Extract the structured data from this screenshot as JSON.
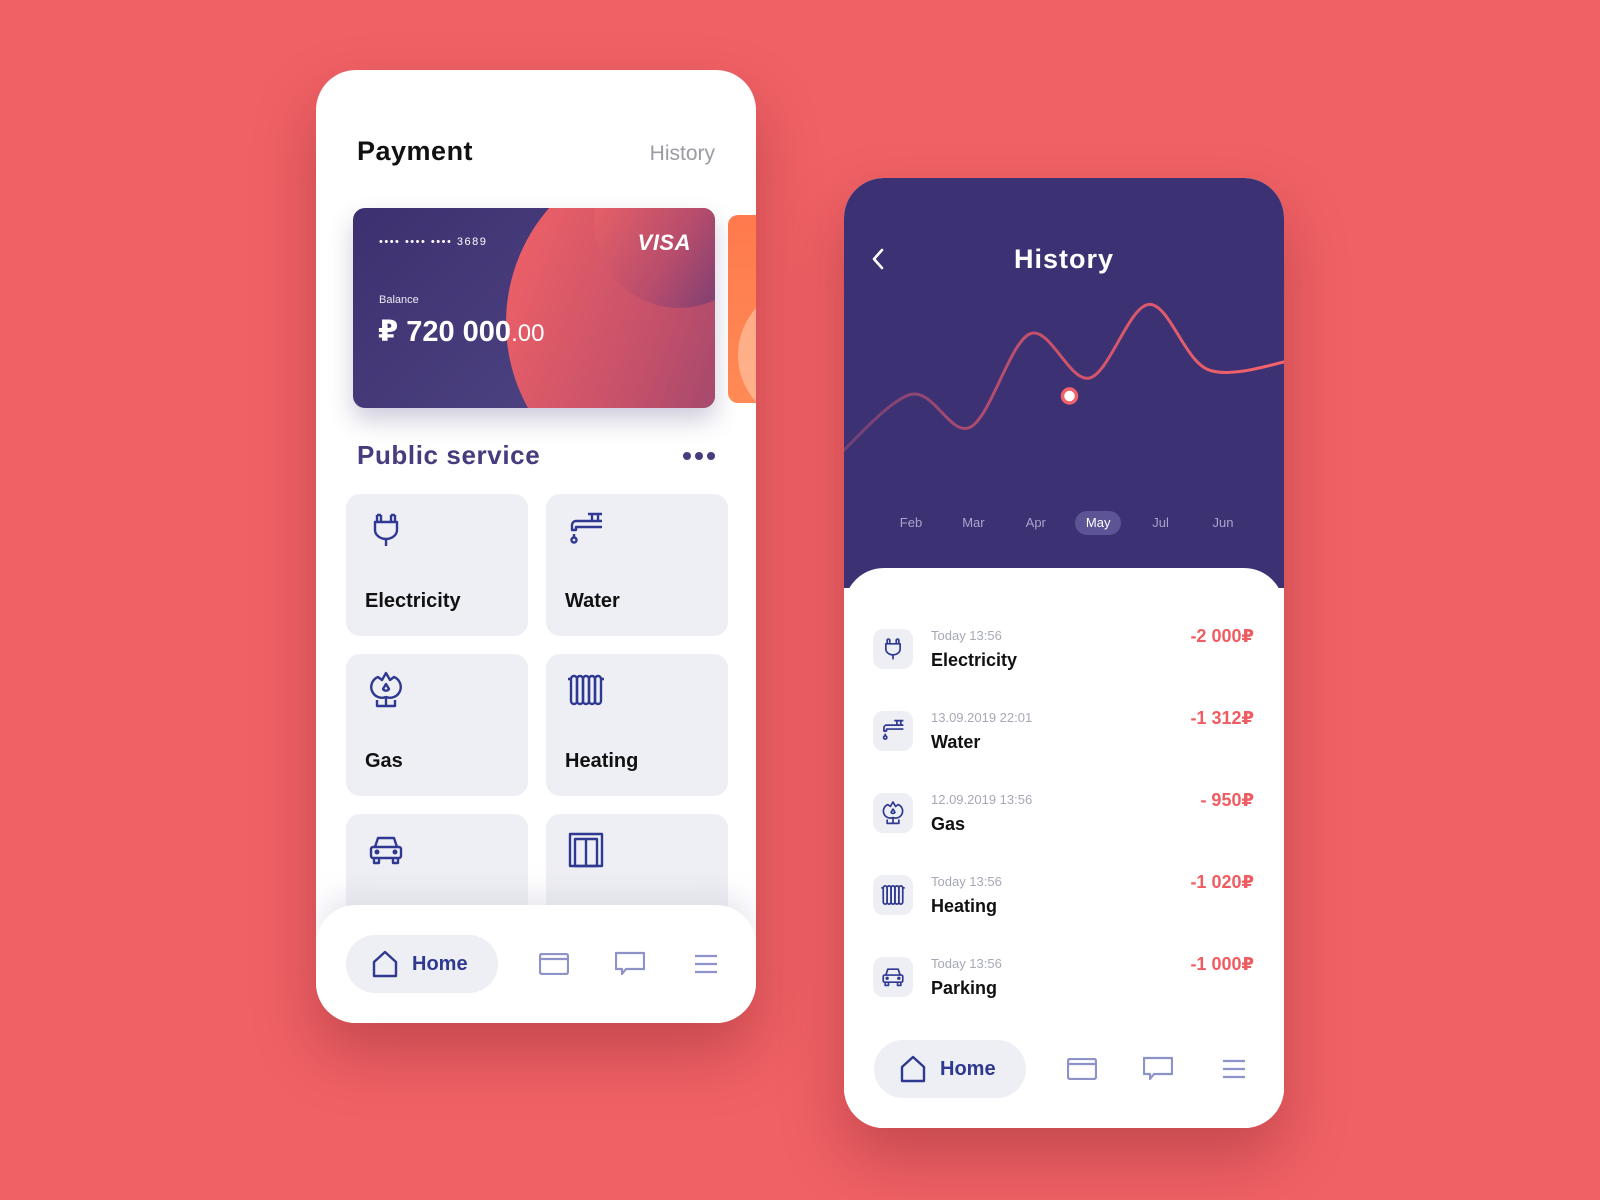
{
  "payment_screen": {
    "title": "Payment",
    "history_link": "History",
    "card": {
      "number_masked": "•••• •••• •••• 3689",
      "brand": "VISA",
      "balance_label": "Balance",
      "balance_main": "₽ 720 000",
      "balance_cents": ".00"
    },
    "section_title": "Public service",
    "services": [
      {
        "label": "Electricity",
        "icon": "plug-icon"
      },
      {
        "label": "Water",
        "icon": "faucet-icon"
      },
      {
        "label": "Gas",
        "icon": "gas-flame-icon"
      },
      {
        "label": "Heating",
        "icon": "radiator-icon"
      },
      {
        "label": "",
        "icon": "car-icon"
      },
      {
        "label": "",
        "icon": "elevator-icon"
      }
    ],
    "nav": {
      "home_label": "Home"
    }
  },
  "history_screen": {
    "title": "History",
    "months": [
      "Feb",
      "Mar",
      "Apr",
      "May",
      "Jul",
      "Jun"
    ],
    "active_month": "May",
    "transactions": [
      {
        "time": "Today 13:56",
        "name": "Electricity",
        "amount": "-2 000₽",
        "icon": "plug-icon"
      },
      {
        "time": "13.09.2019 22:01",
        "name": "Water",
        "amount": "-1 312₽",
        "icon": "faucet-icon"
      },
      {
        "time": "12.09.2019 13:56",
        "name": "Gas",
        "amount": "- 950₽",
        "icon": "gas-flame-icon"
      },
      {
        "time": "Today 13:56",
        "name": "Heating",
        "amount": "-1 020₽",
        "icon": "radiator-icon"
      },
      {
        "time": "Today 13:56",
        "name": "Parking",
        "amount": "-1 000₽",
        "icon": "car-icon"
      }
    ],
    "nav": {
      "home_label": "Home"
    }
  },
  "chart_data": {
    "type": "line",
    "title": "",
    "categories": [
      "Feb",
      "Mar",
      "Apr",
      "May",
      "Jul",
      "Jun"
    ],
    "series": [
      {
        "name": "spending",
        "values": [
          0.45,
          0.25,
          0.82,
          0.55,
          1.0,
          0.6
        ]
      }
    ],
    "highlighted": "May",
    "ylim": [
      0,
      1.1
    ],
    "grid": false
  },
  "colors": {
    "background": "#EF6164",
    "primary": "#3b3173",
    "accent": "#ef5c62",
    "icon": "#2f3991"
  }
}
